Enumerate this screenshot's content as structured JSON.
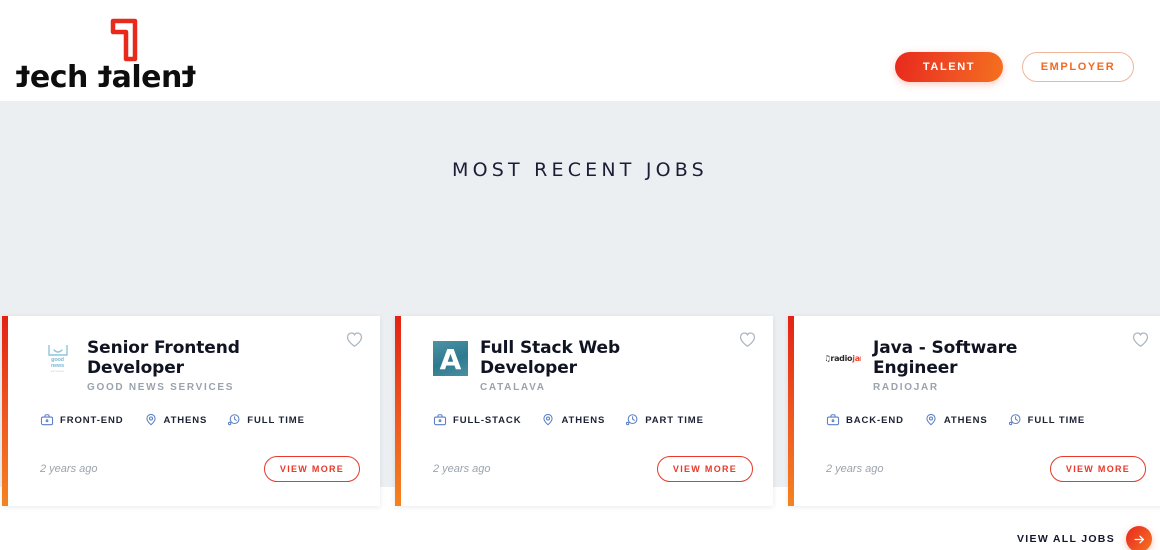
{
  "header": {
    "logo": {
      "name": "tech-talent-logo",
      "word_parts": [
        "t",
        "ech ",
        "t",
        "alen",
        "t"
      ],
      "wordmark": "tech talent",
      "mark_icon": "flag-one-mark-icon",
      "mark_color": "#e8291c"
    },
    "buttons": [
      {
        "label": "TALENT",
        "name": "talent-button",
        "style": "filled",
        "color": "#ef5023"
      },
      {
        "label": "EMPLOYER",
        "name": "employer-button",
        "style": "outline",
        "color": "#ef6a22"
      }
    ]
  },
  "section": {
    "title": "MOST RECENT JOBS",
    "background": "#eceff2"
  },
  "cards": [
    {
      "title": "Senior Frontend Developer",
      "company": "GOOD NEWS SERVICES",
      "logo_kind": "good-news-services-logo",
      "logo_text": "good news services",
      "meta": [
        {
          "icon": "briefcase-icon",
          "label": "FRONT-END"
        },
        {
          "icon": "location-pin-icon",
          "label": "ATHENS"
        },
        {
          "icon": "clock-icon",
          "label": "FULL TIME"
        }
      ],
      "posted": "2 years ago",
      "action": "VIEW MORE",
      "favorite_icon": "heart-outline-icon"
    },
    {
      "title": "Full Stack Web Developer",
      "company": "CATALAVA",
      "logo_kind": "catalava-logo",
      "logo_text": "A",
      "meta": [
        {
          "icon": "briefcase-icon",
          "label": "FULL-STACK"
        },
        {
          "icon": "location-pin-icon",
          "label": "ATHENS"
        },
        {
          "icon": "clock-icon",
          "label": "PART TIME"
        }
      ],
      "posted": "2 years ago",
      "action": "VIEW MORE",
      "favorite_icon": "heart-outline-icon"
    },
    {
      "title": "Java - Software Engineer",
      "company": "RADIOJAR",
      "logo_kind": "radiojar-logo",
      "logo_text": "radiojar",
      "meta": [
        {
          "icon": "briefcase-icon",
          "label": "BACK-END"
        },
        {
          "icon": "location-pin-icon",
          "label": "ATHENS"
        },
        {
          "icon": "clock-icon",
          "label": "FULL TIME"
        }
      ],
      "posted": "2 years ago",
      "action": "VIEW MORE",
      "favorite_icon": "heart-outline-icon"
    }
  ],
  "view_all": {
    "label": "VIEW ALL JOBS",
    "icon": "arrow-right-icon",
    "color": "#ef5023"
  },
  "colors": {
    "accent_red": "#e8291c",
    "accent_orange": "#f4761d",
    "meta_icon_blue": "#5b7fc4",
    "page_bg": "#ffffff",
    "section_bg": "#eceff2"
  }
}
